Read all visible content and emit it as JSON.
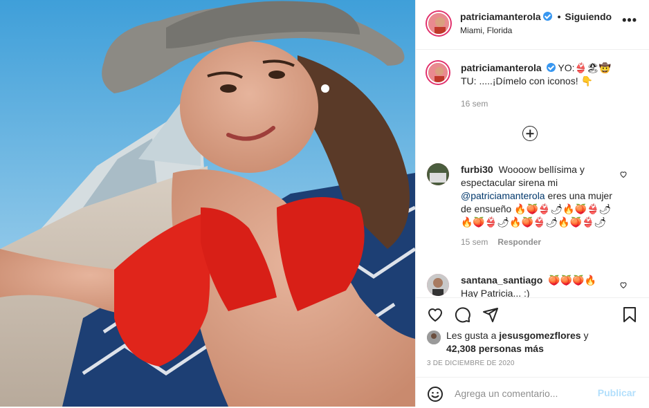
{
  "post": {
    "username": "patriciamanterola",
    "follow_label": "Siguiendo",
    "location": "Miami, Florida",
    "more_label": "•••"
  },
  "caption": {
    "username": "patriciamanterola",
    "line1": "YO:👙🏖🤠",
    "line2": "TU: .....¡Dímelo con iconos! 👇",
    "time": "16 sem"
  },
  "comments": [
    {
      "username": "furbi30",
      "text_before": "Woooow bellísima y espectacular sirena mi",
      "mention": "@patriciamanterola",
      "text_after": "eres una mujer de ensueño 🔥🍑👙🌶🔥🍑👙🌶🔥🍑👙🌶🔥🍑👙🌶🔥🍑👙🌶",
      "time": "15 sem",
      "reply_label": "Responder"
    },
    {
      "username": "santana_santiago",
      "text": "🍑🍑🍑🔥",
      "text2": "Hay Patricia... :)"
    }
  ],
  "likes": {
    "prefix": "Les gusta a",
    "user": "jesusgomezflores",
    "suffix": "y",
    "count": "42,308 personas más"
  },
  "date": "3 DE DICIEMBRE DE 2020",
  "comment_box": {
    "placeholder": "Agrega un comentario...",
    "publish_label": "Publicar"
  },
  "icons": {
    "like": "heart-icon",
    "comment": "comment-icon",
    "share": "share-icon",
    "save": "bookmark-icon",
    "emoji": "emoji-icon",
    "add": "plus-circle-icon"
  },
  "colors": {
    "verified": "#3897f0",
    "mention": "#00376b",
    "publish_disabled": "#b2dffc",
    "meta": "#8e8e8e"
  }
}
